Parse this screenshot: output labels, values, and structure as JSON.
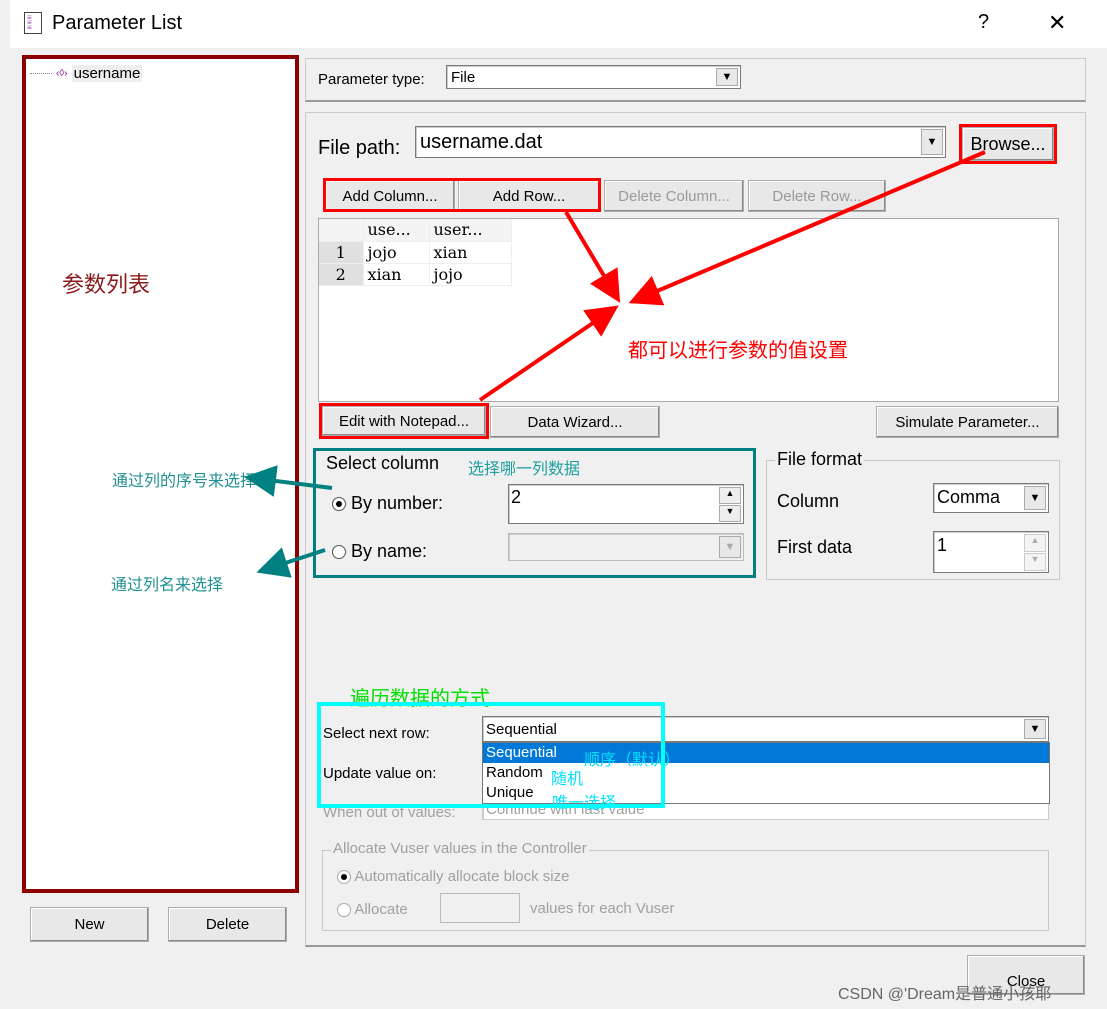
{
  "window": {
    "title": "Parameter List",
    "help": "?",
    "close": "✕"
  },
  "param_list": {
    "items": [
      "username"
    ],
    "new_label": "New",
    "delete_label": "Delete"
  },
  "param_type": {
    "label": "Parameter type:",
    "value": "File"
  },
  "file": {
    "path_label": "File path:",
    "path_value": "username.dat",
    "browse": "Browse...",
    "add_column": "Add Column...",
    "add_row": "Add Row...",
    "delete_column": "Delete Column...",
    "delete_row": "Delete Row...",
    "edit_notepad": "Edit with Notepad...",
    "data_wizard": "Data Wizard...",
    "simulate": "Simulate Parameter..."
  },
  "table": {
    "headers": [
      "use...",
      "user..."
    ],
    "rows": [
      [
        "1",
        "jojo",
        "xian"
      ],
      [
        "2",
        "xian",
        "jojo"
      ]
    ]
  },
  "select_column": {
    "title": "Select column",
    "by_number": "By number:",
    "number_value": "2",
    "by_name": "By name:",
    "selected": "by_number"
  },
  "file_format": {
    "title": "File format",
    "column_label": "Column",
    "column_value": "Comma",
    "first_data_label": "First data",
    "first_data_value": "1"
  },
  "rows": {
    "select_next_label": "Select next row:",
    "select_next_value": "Sequential",
    "options": [
      "Sequential",
      "Random",
      "Unique"
    ],
    "update_label": "Update value on:",
    "out_of_values_label": "When out of values:",
    "out_of_values_value": "Continue with last value"
  },
  "allocate": {
    "title": "Allocate Vuser values in the Controller",
    "auto": "Automatically allocate block size",
    "allocate": "Allocate",
    "suffix": "values for each Vuser"
  },
  "close_label": "Close",
  "annotations": {
    "param_list": "参数列表",
    "all_set": "都可以进行参数的值设置",
    "which_column": "选择哪一列数据",
    "by_number": "通过列的序号来选择",
    "by_name": "通过列名来选择",
    "traverse": "遍历数据的方式",
    "sequential": "顺序（默认）",
    "random": "随机",
    "unique": "唯一选择"
  },
  "watermark": "CSDN @'Dream是普通小孩耶",
  "colors": {
    "dark_red": "#8b0000",
    "red": "#ff0000",
    "teal": "#008080",
    "cyan": "#00ffff",
    "green": "#00ff00",
    "highlight": "#0078d7"
  }
}
